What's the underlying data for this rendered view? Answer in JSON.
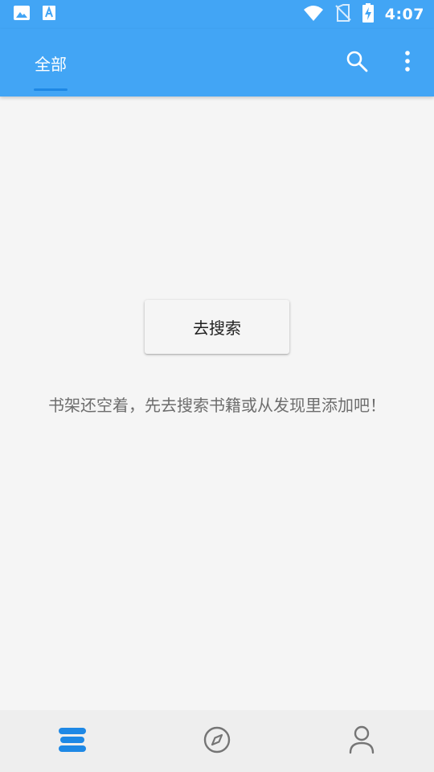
{
  "status_bar": {
    "time": "4:07",
    "left_icons": [
      "image-icon",
      "text-app-icon"
    ],
    "right_icons": [
      "wifi-icon",
      "no-sim-icon",
      "battery-charging-icon"
    ]
  },
  "app_bar": {
    "tabs": [
      {
        "label": "全部",
        "selected": true
      }
    ],
    "actions": [
      "search-icon",
      "more-vert-icon"
    ]
  },
  "content": {
    "search_button_label": "去搜索",
    "empty_message": "书架还空着，先去搜索书籍或从发现里添加吧！"
  },
  "bottom_nav": {
    "items": [
      {
        "icon": "bookshelf-icon",
        "active": true
      },
      {
        "icon": "compass-icon",
        "active": false
      },
      {
        "icon": "person-icon",
        "active": false
      }
    ]
  },
  "colors": {
    "primary": "#42a5f5",
    "accent": "#1e88e5",
    "background": "#f5f5f5",
    "bottom_nav": "#eeeeee",
    "inactive_icon": "#757575"
  }
}
